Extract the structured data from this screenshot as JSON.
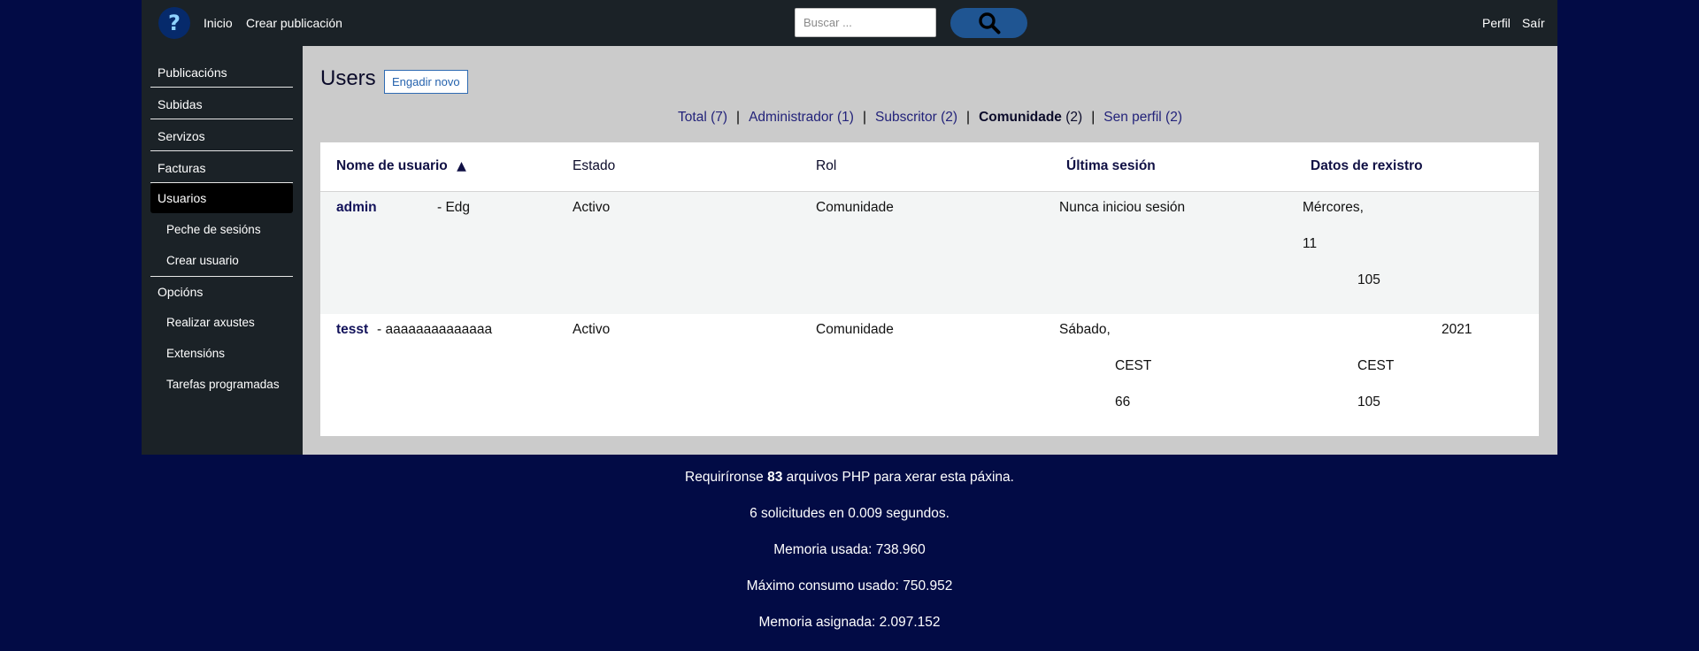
{
  "header": {
    "logo_glyph": "?",
    "nav": [
      {
        "label": "Inicio"
      },
      {
        "label": "Crear publicación"
      }
    ],
    "search_placeholder": "Buscar ...",
    "search_icon": "search-icon",
    "right_links": [
      {
        "label": "Perfil"
      },
      {
        "label": "Saír"
      }
    ]
  },
  "sidebar": {
    "items": [
      {
        "label": "Publicacións"
      },
      {
        "label": "Subidas"
      },
      {
        "label": "Servizos"
      },
      {
        "label": "Facturas"
      },
      {
        "label": "Usuarios",
        "active": true
      },
      {
        "label": "Peche de sesións"
      },
      {
        "label": "Crear usuario"
      },
      {
        "label": "Opcións"
      },
      {
        "label": "Realizar axustes"
      },
      {
        "label": "Extensións"
      },
      {
        "label": "Tarefas programadas"
      }
    ]
  },
  "main": {
    "title": "Users",
    "add_new_label": "Engadir novo",
    "filters": [
      {
        "label": "Total",
        "count": "(7)"
      },
      {
        "label": "Administrador",
        "count": "(1)"
      },
      {
        "label": "Subscritor",
        "count": "(2)"
      },
      {
        "label": "Comunidade",
        "count": "(2)",
        "current": true
      },
      {
        "label": "Sen perfil",
        "count": "(2)"
      }
    ],
    "table": {
      "columns": [
        {
          "label": "Nome de usuario",
          "sort_indicator": "▲"
        },
        {
          "label": "Estado"
        },
        {
          "label": "Rol"
        },
        {
          "label": "Última sesión"
        },
        {
          "label": "Datos de rexistro"
        }
      ],
      "rows": [
        {
          "username": "admin",
          "suffix": "- Edg",
          "status": "Activo",
          "role": "Comunidade",
          "last_session": [
            "Nunca iniciou sesión"
          ],
          "registration": [
            "Mércores,",
            "11",
            "105"
          ]
        },
        {
          "username": "tesst",
          "suffix": "- aaaaaaaaaaaaaa",
          "status": "Activo",
          "role": "Comunidade",
          "last_session": [
            "Sábado,",
            "CEST",
            "66"
          ],
          "registration": [
            "2021",
            "CEST",
            "105"
          ]
        }
      ]
    }
  },
  "footer": {
    "lines": [
      {
        "prefix": "Requiríronse ",
        "value": "83",
        "suffix": " arquivos PHP para xerar esta páxina."
      },
      {
        "text": "6 solicitudes en 0.009 segundos."
      },
      {
        "text": "Memoria usada: 738.960"
      },
      {
        "text": "Máximo consumo usado: 750.952"
      },
      {
        "text": "Memoria asignada: 2.097.152"
      }
    ]
  },
  "colors": {
    "page_background": "#020b45",
    "bar_background": "#1b2227",
    "content_background": "#cbcbcb",
    "search_button": "#1f5592",
    "link_blue": "#2562ad"
  }
}
